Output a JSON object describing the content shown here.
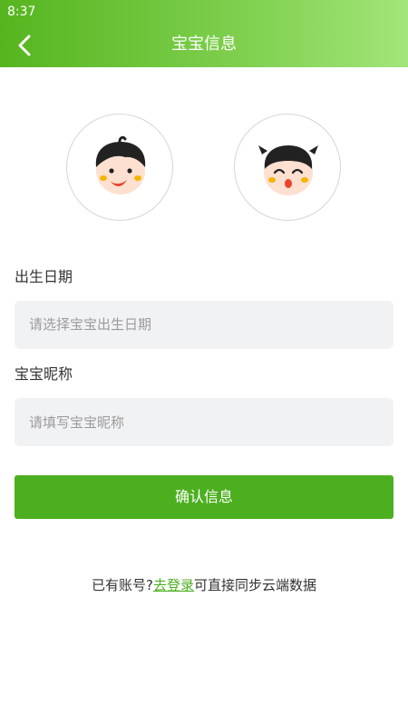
{
  "status_bar": {
    "time": "8:37"
  },
  "header": {
    "title": "宝宝信息",
    "back_icon": "chevron-left-icon"
  },
  "avatars": [
    {
      "name": "boy-avatar"
    },
    {
      "name": "girl-avatar"
    }
  ],
  "form": {
    "birth_label": "出生日期",
    "birth_placeholder": "请选择宝宝出生日期",
    "nick_label": "宝宝昵称",
    "nick_placeholder": "请填写宝宝昵称"
  },
  "confirm_label": "确认信息",
  "footer": {
    "prefix": "已有账号?",
    "login_link": "去登录",
    "suffix": "可直接同步云端数据"
  },
  "colors": {
    "header_start": "#56b51f",
    "header_end": "#a3e57a",
    "accent": "#4caf1f",
    "input_bg": "#f1f2f4"
  }
}
